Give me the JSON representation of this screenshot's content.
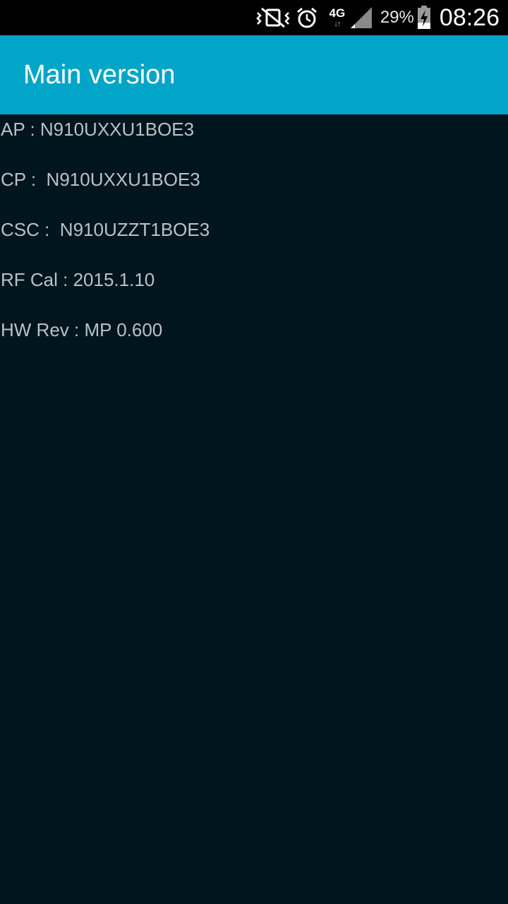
{
  "status_bar": {
    "network_label": "4G",
    "network_arrows": "↓↑",
    "battery_percent": "29%",
    "battery_level_fraction": 0.29,
    "charging": true,
    "time": "08:26",
    "icons": [
      "vibrate-mute-icon",
      "alarm-icon",
      "network-4g-icon",
      "signal-icon",
      "battery-charging-icon"
    ]
  },
  "action_bar": {
    "title": "Main version",
    "color": "#00a5c7"
  },
  "info": {
    "rows": [
      {
        "text": "AP : N910UXXU1BOE3"
      },
      {
        "text": "CP :  N910UXXU1BOE3"
      },
      {
        "text": "CSC :  N910UZZT1BOE3"
      },
      {
        "text": "RF Cal : 2015.1.10"
      },
      {
        "text": "HW Rev : MP 0.600"
      }
    ]
  },
  "colors": {
    "background": "#00151e",
    "text": "#b9c2c7",
    "status_bar": "#000000"
  }
}
